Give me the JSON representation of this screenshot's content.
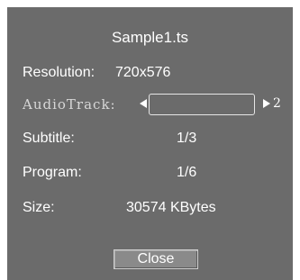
{
  "dialog": {
    "title": "Sample1.ts",
    "resolution": {
      "label": "Resolution:",
      "value": "720x576"
    },
    "audio_track": {
      "label": "AudioTrack:",
      "count": "2",
      "selected": ""
    },
    "subtitle": {
      "label": "Subtitle:",
      "value": "1/3"
    },
    "program": {
      "label": "Program:",
      "value": "1/6"
    },
    "size": {
      "label": "Size:",
      "value": "30574 KBytes"
    },
    "close_label": "Close"
  },
  "colors": {
    "panel": "#6b6b6b",
    "text": "#ffffff",
    "button": "#8a8a8a"
  },
  "icons": {
    "prev": "triangle-left-icon",
    "next": "triangle-right-icon"
  }
}
